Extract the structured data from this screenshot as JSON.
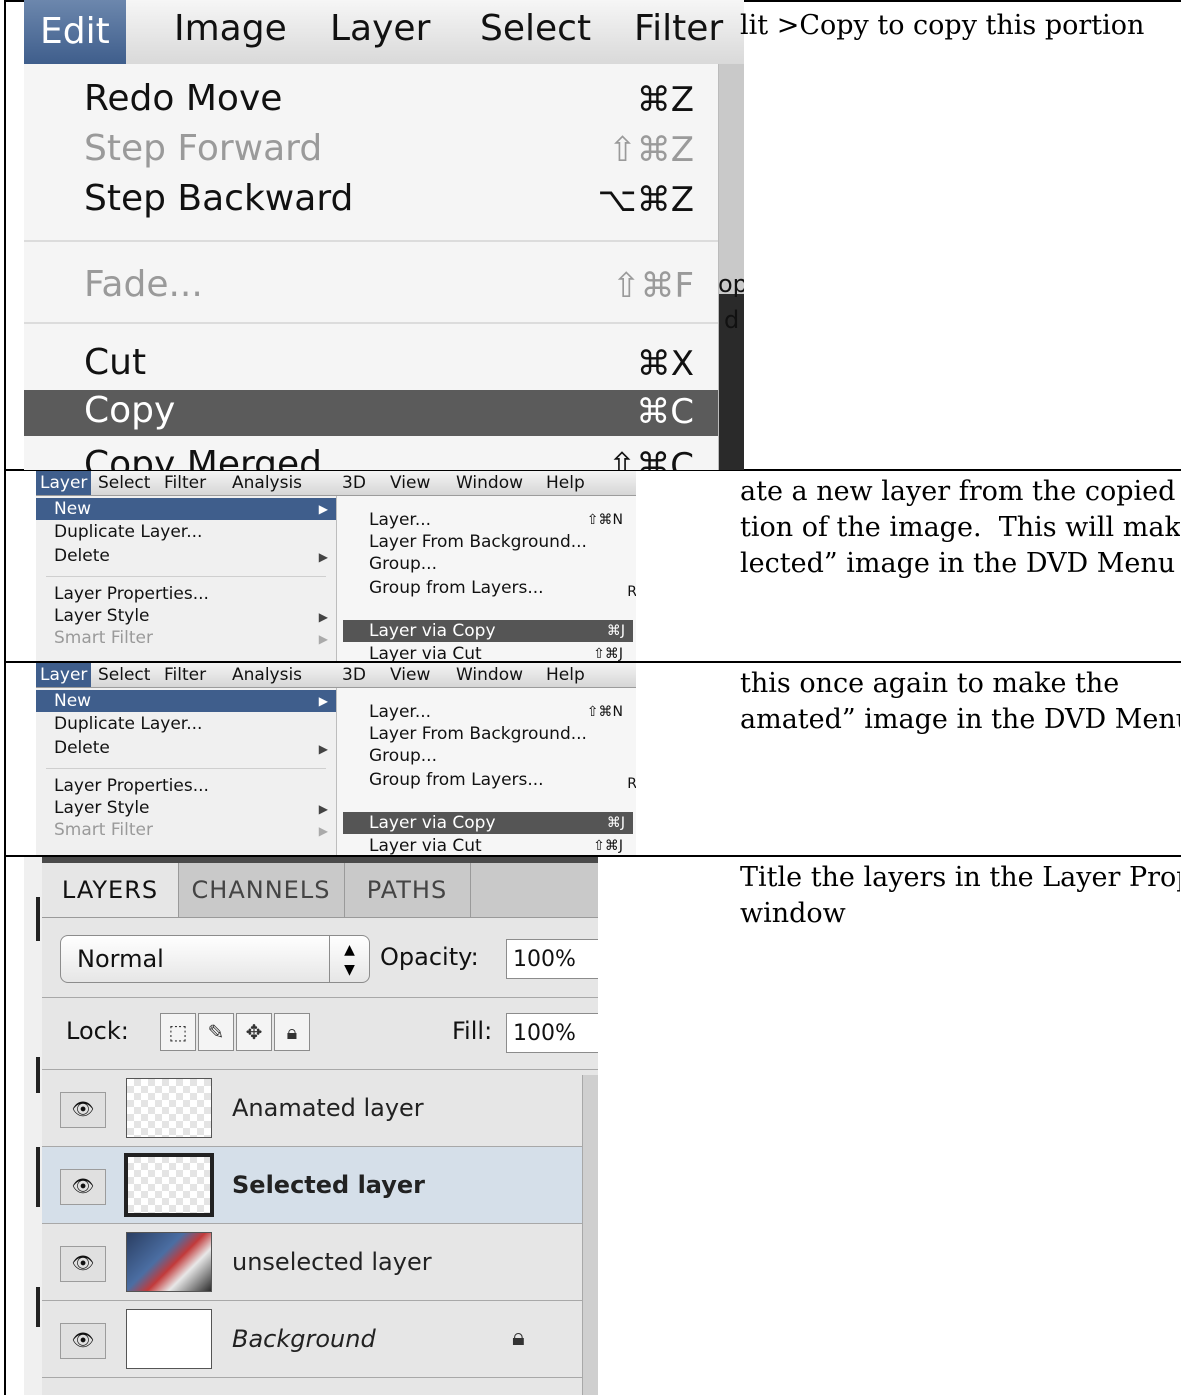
{
  "captions": [
    "lit >Copy to copy this portion",
    "ate a new layer from the copied\ntion of the image.  This will make the\nlected” image in the DVD Menu",
    "this once again to make the\namated” image in the DVD Menu",
    "Title the layers in the Layer Properties\nwindow"
  ],
  "edit_menu": {
    "menubar": [
      "Edit",
      "Image",
      "Layer",
      "Select",
      "Filter"
    ],
    "items": [
      {
        "label": "Redo Move",
        "shortcut": "⌘Z",
        "disabled": false
      },
      {
        "label": "Step Forward",
        "shortcut": "⇧⌘Z",
        "disabled": true
      },
      {
        "label": "Step Backward",
        "shortcut": "⌥⌘Z",
        "disabled": false
      },
      {
        "label": "Fade...",
        "shortcut": "⇧⌘F",
        "disabled": true
      },
      {
        "label": "Cut",
        "shortcut": "⌘X",
        "disabled": false
      },
      {
        "label": "Copy",
        "shortcut": "⌘C",
        "disabled": false
      },
      {
        "label": "Copy Merged",
        "shortcut": "⇧⌘C",
        "disabled": false
      }
    ],
    "right_bits": [
      "op",
      "d"
    ]
  },
  "layer_menu": {
    "menubar": [
      "Layer",
      "Select",
      "Filter",
      "Analysis",
      "3D",
      "View",
      "Window",
      "Help"
    ],
    "items": [
      "New",
      "Duplicate Layer...",
      "Delete",
      "Layer Properties...",
      "Layer Style",
      "Smart Filter"
    ],
    "submenu": [
      {
        "label": "Layer...",
        "shortcut": "⇧⌘N"
      },
      {
        "label": "Layer From Background...",
        "shortcut": ""
      },
      {
        "label": "Group...",
        "shortcut": ""
      },
      {
        "label": "Group from Layers...",
        "shortcut": ""
      },
      {
        "label": "Layer via Copy",
        "shortcut": "⌘J"
      },
      {
        "label": "Layer via Cut",
        "shortcut": "⇧⌘J"
      }
    ],
    "edge_letter": "R"
  },
  "layers_panel": {
    "tabs": [
      "LAYERS",
      "CHANNELS",
      "PATHS"
    ],
    "blend_mode": "Normal",
    "opacity_label": "Opacity:",
    "opacity": "100%",
    "lock_label": "Lock:",
    "fill_label": "Fill:",
    "fill": "100%",
    "layers": [
      {
        "name": "Anamated layer",
        "selected": false
      },
      {
        "name": "Selected layer",
        "selected": true
      },
      {
        "name": "unselected layer",
        "selected": false
      },
      {
        "name": "Background",
        "selected": false,
        "locked": true
      }
    ]
  }
}
